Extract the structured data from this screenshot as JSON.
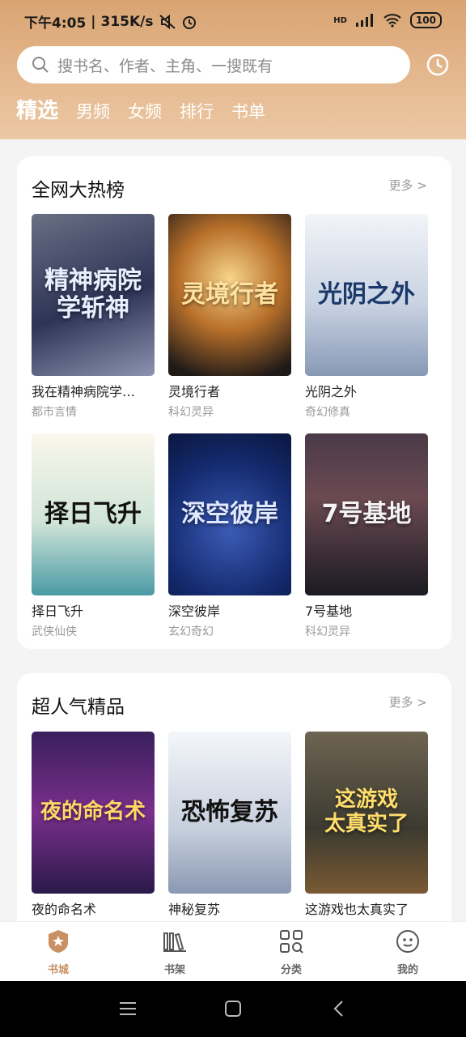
{
  "status": {
    "time": "下午4:05",
    "speed": "315K/s",
    "signal": "HD",
    "battery": "100"
  },
  "search": {
    "placeholder": "搜书名、作者、主角、一搜既有"
  },
  "tabs": [
    {
      "label": "精选",
      "active": true
    },
    {
      "label": "男频"
    },
    {
      "label": "女频"
    },
    {
      "label": "排行"
    },
    {
      "label": "书单"
    }
  ],
  "sections": [
    {
      "title": "全网大热榜",
      "more": "更多 >",
      "books": [
        {
          "title": "我在精神病院学…",
          "genre": "都市言情",
          "cover_text": "精神病院\n学斩神"
        },
        {
          "title": "灵境行者",
          "genre": "科幻灵异",
          "cover_text": "灵境行者"
        },
        {
          "title": "光阴之外",
          "genre": "奇幻修真",
          "cover_text": "光阴之外"
        },
        {
          "title": "择日飞升",
          "genre": "武侠仙侠",
          "cover_text": "择日飞升"
        },
        {
          "title": "深空彼岸",
          "genre": "玄幻奇幻",
          "cover_text": "深空彼岸"
        },
        {
          "title": "7号基地",
          "genre": "科幻灵异",
          "cover_text": "7号基地"
        }
      ]
    },
    {
      "title": "超人气精品",
      "more": "更多 >",
      "books": [
        {
          "title": "夜的命名术",
          "genre": "",
          "cover_text": "夜的命名术"
        },
        {
          "title": "神秘复苏",
          "genre": "",
          "cover_text": "恐怖复苏"
        },
        {
          "title": "这游戏也太真实了",
          "genre": "",
          "cover_text": "这游戏\n太真实了"
        }
      ]
    }
  ],
  "nav": [
    {
      "label": "书城",
      "icon": "star-icon",
      "active": true
    },
    {
      "label": "书架",
      "icon": "bookshelf-icon"
    },
    {
      "label": "分类",
      "icon": "category-icon"
    },
    {
      "label": "我的",
      "icon": "profile-icon"
    }
  ],
  "colors": {
    "accent": "#c99063",
    "header": "#d9a472"
  }
}
